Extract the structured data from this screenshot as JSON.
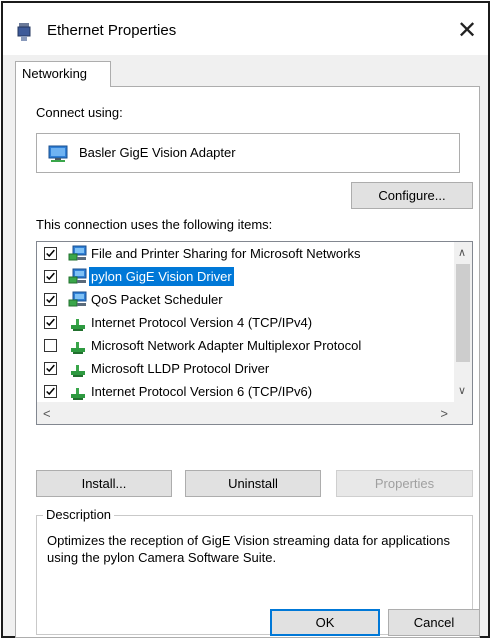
{
  "window": {
    "title": "Ethernet Properties",
    "close_label": "✕",
    "title_icon": "network-adapter-icon"
  },
  "tabs": [
    {
      "label": "Networking",
      "selected": true
    }
  ],
  "connect": {
    "label": "Connect using:",
    "adapter_name": "Basler GigE Vision Adapter",
    "adapter_icon": "network-adapter-icon",
    "configure_label": "Configure..."
  },
  "items": {
    "label": "This connection uses the following items:",
    "list": [
      {
        "label": "File and Printer Sharing for Microsoft Networks",
        "checked": true,
        "selected": false,
        "icon": "network-service-icon"
      },
      {
        "label": "pylon GigE Vision Driver",
        "checked": true,
        "selected": true,
        "icon": "network-service-icon"
      },
      {
        "label": "QoS Packet Scheduler",
        "checked": true,
        "selected": false,
        "icon": "network-service-icon"
      },
      {
        "label": "Internet Protocol Version 4 (TCP/IPv4)",
        "checked": true,
        "selected": false,
        "icon": "protocol-icon"
      },
      {
        "label": "Microsoft Network Adapter Multiplexor Protocol",
        "checked": false,
        "selected": false,
        "icon": "protocol-icon"
      },
      {
        "label": "Microsoft LLDP Protocol Driver",
        "checked": true,
        "selected": false,
        "icon": "protocol-icon"
      },
      {
        "label": "Internet Protocol Version 6 (TCP/IPv6)",
        "checked": true,
        "selected": false,
        "icon": "protocol-icon"
      }
    ]
  },
  "buttons": {
    "install": "Install...",
    "uninstall": "Uninstall",
    "properties": "Properties",
    "ok": "OK",
    "cancel": "Cancel"
  },
  "description": {
    "legend": "Description",
    "text": "Optimizes the reception of GigE Vision streaming data for applications using the pylon Camera Software Suite."
  },
  "colors": {
    "selection": "#0078d7",
    "dialog_bg": "#f0f0f0",
    "panel_bg": "#ffffff"
  }
}
